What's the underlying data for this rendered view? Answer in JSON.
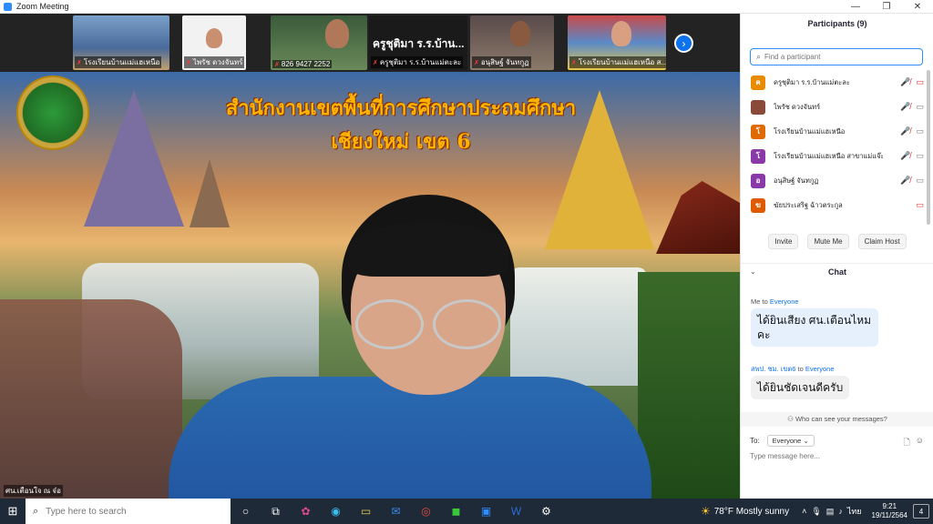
{
  "window": {
    "title": "Zoom Meeting",
    "minimize": "—",
    "restore": "❐",
    "close": "✕"
  },
  "gallery": {
    "tiles": [
      {
        "name": "โรงเรียนบ้านแม่แฮเหนือ",
        "big_label": ""
      },
      {
        "name": "ไพรัช ดวงจันทร์",
        "big_label": ""
      },
      {
        "name": "826 9427 2252",
        "big_label": ""
      },
      {
        "name": "ครูชุติมา ร.ร.บ้านแม่ตะละ",
        "big_label": "ครูชุติมา ร.ร.บ้าน..."
      },
      {
        "name": "อนุสิษฐ์ จันทกูฏ",
        "big_label": ""
      },
      {
        "name": "โรงเรียนบ้านแม่แฮเหนือ ส...",
        "big_label": ""
      }
    ],
    "next_icon": "›"
  },
  "main_video": {
    "banner_line1": "สำนักงานเขตพื้นที่การศึกษาประถมศึกษา",
    "banner_line2": "เชียงใหม่ เขต 6",
    "caption": "ศน.เตือนใจ ณ จ๋อ"
  },
  "participants": {
    "title": "Participants (9)",
    "search_placeholder": "Find a participant",
    "list": [
      {
        "initial": "ค",
        "name": "ครูชุติมา ร.ร.บ้านแม่ตะละ",
        "color": "#e88b00",
        "mic_off": true,
        "cam_off": true
      },
      {
        "initial": "",
        "name": "ไพรัช ดวงจันทร์",
        "color": "#8a4a3a",
        "mic_off": true,
        "cam_off": false
      },
      {
        "initial": "โ",
        "name": "โรงเรียนบ้านแม่แฮเหนือ",
        "color": "#e06a00",
        "mic_off": true,
        "cam_off": false
      },
      {
        "initial": "โ",
        "name": "โรงเรียนบ้านแม่แฮเหนือ สาขาแม่แจ๊ะ",
        "color": "#8a3aa8",
        "mic_off": true,
        "cam_off": false
      },
      {
        "initial": "อ",
        "name": "อนุสิษฐ์ จันทกูฏ",
        "color": "#8a3aa8",
        "mic_off": true,
        "cam_off": false
      },
      {
        "initial": "ฆ",
        "name": "ฆัยประเสริฐ ฉ้าวตระกูล",
        "color": "#e05a00",
        "mic_off": false,
        "cam_off": true
      }
    ],
    "buttons": {
      "invite": "Invite",
      "mute_me": "Mute Me",
      "claim_host": "Claim Host"
    }
  },
  "chat": {
    "title": "Chat",
    "messages": [
      {
        "from": "Me",
        "to_word": "to",
        "to": "Everyone",
        "text": "ได้ยินเสียง ศน.เตือนไหมคะ"
      },
      {
        "from": "สพป. ชม. เขต6",
        "to_word": "to",
        "to": "Everyone",
        "text": "ได้ยินชัดเจนดีครับ"
      }
    ],
    "who_can_see": "Who can see your messages?",
    "to_label": "To:",
    "to_value": "Everyone",
    "input_placeholder": "Type message here..."
  },
  "taskbar": {
    "search_placeholder": "Type here to search",
    "weather": "78°F  Mostly sunny",
    "lang": "ไทย",
    "time": "9:21",
    "date": "19/11/2564",
    "notifications": "4"
  }
}
